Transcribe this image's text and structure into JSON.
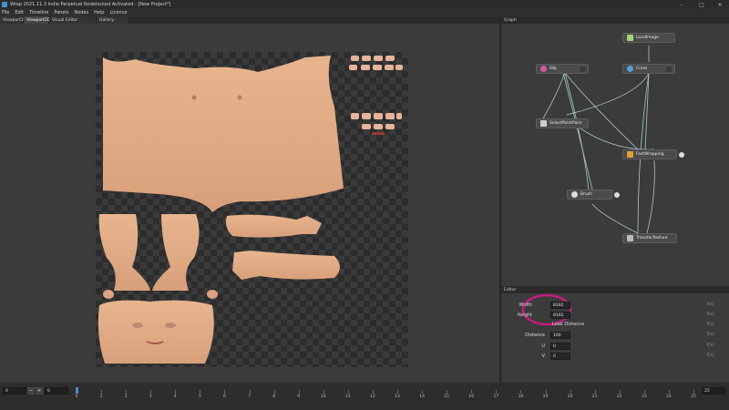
{
  "window": {
    "title": "Wrap 2021.11.3  Indie Perpetual Nodelocked Activated - [New Project*]",
    "controls": [
      "–",
      "□",
      "✕"
    ]
  },
  "menu": [
    "File",
    "Edit",
    "Timeline",
    "Panels",
    "Nodes",
    "Help",
    "Licence"
  ],
  "tabs": [
    {
      "label": "Viewport3D",
      "active": false
    },
    {
      "label": "Viewport2D",
      "active": true
    },
    {
      "label": "Visual Editor",
      "active": false
    },
    {
      "label": "Gallery",
      "active": false
    }
  ],
  "graph": {
    "header": "Graph",
    "nodes": [
      {
        "id": "loadimage",
        "label": "LoadImage",
        "icon_color": "#9cd67a"
      },
      {
        "id": "obj",
        "label": "Obj",
        "icon_color": "#d65a9c"
      },
      {
        "id": "cross",
        "label": "Cross",
        "icon_color": "#5a9cd6"
      },
      {
        "id": "selectpointpairs",
        "label": "SelectPointPairs",
        "icon_color": "#cfcfcf"
      },
      {
        "id": "fastwrapping",
        "label": "FastWrapping",
        "icon_color": "#e0a030"
      },
      {
        "id": "brush",
        "label": "Brush",
        "icon_color": "#dddddd"
      },
      {
        "id": "transfertexture",
        "label": "TransferTexture",
        "icon_color": "#bbbbbb"
      }
    ]
  },
  "editor": {
    "header": "Editor",
    "props": [
      {
        "label": "Width",
        "value": "8192"
      },
      {
        "label": "Height",
        "value": "8192"
      },
      {
        "label": "Distance",
        "value": "100"
      },
      {
        "label": "U",
        "value": "0"
      },
      {
        "label": "V",
        "value": "0"
      }
    ],
    "extra_label": "Leak Distance",
    "fx": "f(x)"
  },
  "timeline": {
    "start": "0",
    "current": "0",
    "end": "25",
    "ticks": [
      "0",
      "1",
      "2",
      "3",
      "4",
      "5",
      "6",
      "7",
      "8",
      "9",
      "10",
      "11",
      "12",
      "13",
      "14",
      "15",
      "16",
      "17",
      "18",
      "19",
      "20",
      "21",
      "22",
      "23",
      "24",
      "25"
    ]
  },
  "accent_color": "#c21d7c"
}
